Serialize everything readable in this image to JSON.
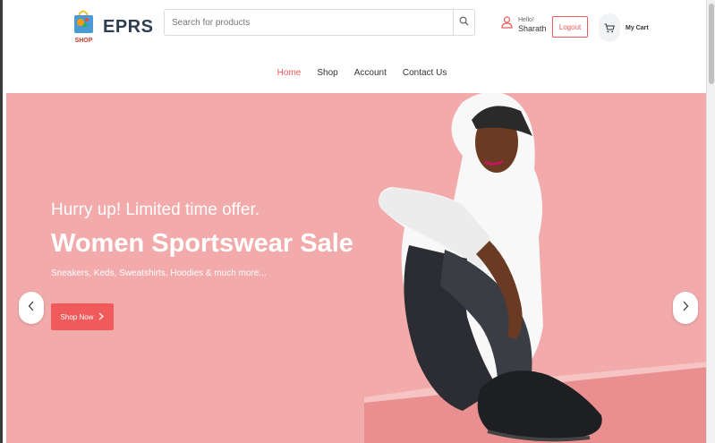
{
  "brand": {
    "name": "EPRS",
    "logo_text": "SHOP"
  },
  "search": {
    "placeholder": "Search for products"
  },
  "user": {
    "greeting": "Hello!",
    "name": "Sharath"
  },
  "logout_label": "Logout",
  "cart_label": "My Cart",
  "nav": {
    "items": [
      {
        "label": "Home",
        "active": true
      },
      {
        "label": "Shop"
      },
      {
        "label": "Account"
      },
      {
        "label": "Contact Us"
      }
    ]
  },
  "hero": {
    "subtitle": "Hurry up! Limited time offer.",
    "title": "Women Sportswear Sale",
    "description": "Sneakers, Keds, Sweatshirts, Hoodies & much more...",
    "button_label": "Shop Now",
    "background_color": "#f2aaaa"
  },
  "colors": {
    "accent": "#f15a5a",
    "text": "#333333"
  },
  "icons": {
    "search": "search-icon",
    "user": "user-icon",
    "cart": "cart-icon",
    "prev": "chevron-left-icon",
    "next": "chevron-right-icon"
  }
}
